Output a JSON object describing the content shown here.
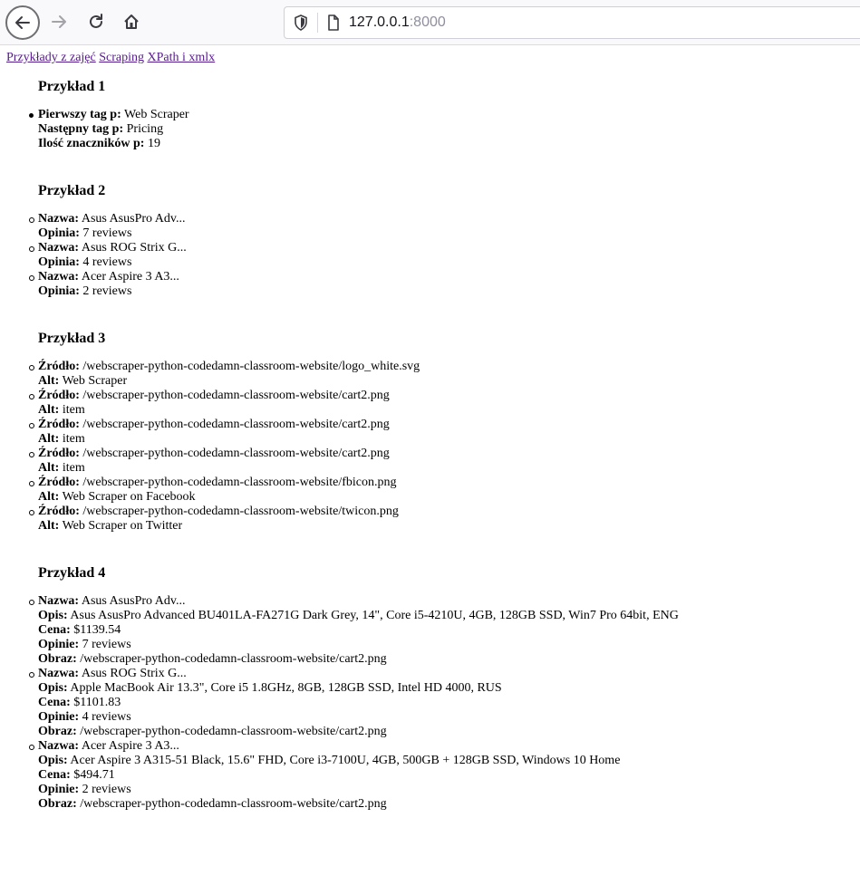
{
  "browser": {
    "url_host": "127.0.0.1",
    "url_port": ":8000"
  },
  "nav_links": [
    "Przykłady z zajęć",
    "Scraping",
    "XPath i xmlx"
  ],
  "ex1": {
    "title": "Przykład 1",
    "rows": [
      {
        "label": "Pierwszy tag p:",
        "value": " Web Scraper"
      },
      {
        "label": "Następny tag p:",
        "value": " Pricing"
      },
      {
        "label": "Ilość znaczników p:",
        "value": " 19"
      }
    ]
  },
  "ex2": {
    "title": "Przykład 2",
    "items": [
      {
        "l1": "Nazwa:",
        "v1": " Asus AsusPro Adv...",
        "l2": "Opinia:",
        "v2": " 7 reviews"
      },
      {
        "l1": "Nazwa:",
        "v1": " Asus ROG Strix G...",
        "l2": "Opinia:",
        "v2": " 4 reviews"
      },
      {
        "l1": "Nazwa:",
        "v1": " Acer Aspire 3 A3...",
        "l2": "Opinia:",
        "v2": " 2 reviews"
      }
    ]
  },
  "ex3": {
    "title": "Przykład 3",
    "items": [
      {
        "l1": "Źródło:",
        "v1": " /webscraper-python-codedamn-classroom-website/logo_white.svg",
        "l2": "Alt:",
        "v2": " Web Scraper"
      },
      {
        "l1": "Źródło:",
        "v1": " /webscraper-python-codedamn-classroom-website/cart2.png",
        "l2": "Alt:",
        "v2": " item"
      },
      {
        "l1": "Źródło:",
        "v1": " /webscraper-python-codedamn-classroom-website/cart2.png",
        "l2": "Alt:",
        "v2": " item"
      },
      {
        "l1": "Źródło:",
        "v1": " /webscraper-python-codedamn-classroom-website/cart2.png",
        "l2": "Alt:",
        "v2": " item"
      },
      {
        "l1": "Źródło:",
        "v1": " /webscraper-python-codedamn-classroom-website/fbicon.png",
        "l2": "Alt:",
        "v2": " Web Scraper on Facebook"
      },
      {
        "l1": "Źródło:",
        "v1": " /webscraper-python-codedamn-classroom-website/twicon.png",
        "l2": "Alt:",
        "v2": " Web Scraper on Twitter"
      }
    ]
  },
  "ex4": {
    "title": "Przykład 4",
    "items": [
      {
        "nazwa": " Asus AsusPro Adv...",
        "opis": " Asus AsusPro Advanced BU401LA-FA271G Dark Grey, 14\", Core i5-4210U, 4GB, 128GB SSD, Win7 Pro 64bit, ENG",
        "cena": " $1139.54",
        "opinie": " 7 reviews",
        "obraz": " /webscraper-python-codedamn-classroom-website/cart2.png"
      },
      {
        "nazwa": " Asus ROG Strix G...",
        "opis": " Apple MacBook Air 13.3\", Core i5 1.8GHz, 8GB, 128GB SSD, Intel HD 4000, RUS",
        "cena": " $1101.83",
        "opinie": " 4 reviews",
        "obraz": " /webscraper-python-codedamn-classroom-website/cart2.png"
      },
      {
        "nazwa": " Acer Aspire 3 A3...",
        "opis": " Acer Aspire 3 A315-51 Black, 15.6\" FHD, Core i3-7100U, 4GB, 500GB + 128GB SSD, Windows 10 Home",
        "cena": " $494.71",
        "opinie": " 2 reviews",
        "obraz": " /webscraper-python-codedamn-classroom-website/cart2.png"
      }
    ],
    "labels": {
      "nazwa": "Nazwa:",
      "opis": "Opis:",
      "cena": "Cena:",
      "opinie": "Opinie:",
      "obraz": "Obraz:"
    }
  }
}
